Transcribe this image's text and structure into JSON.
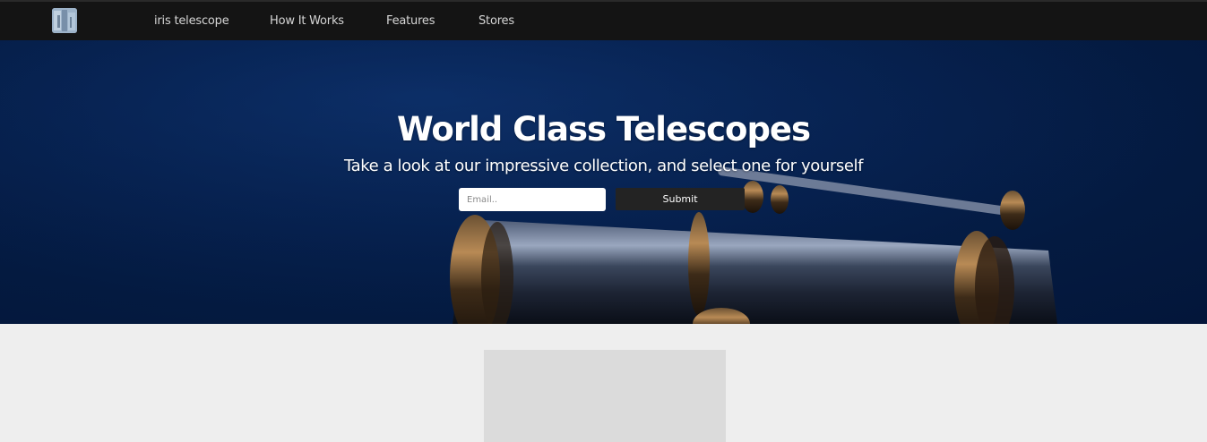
{
  "header": {
    "logo_icon": "telescope-logo-image",
    "nav": [
      {
        "label": "iris telescope"
      },
      {
        "label": "How It Works"
      },
      {
        "label": "Features"
      },
      {
        "label": "Stores"
      }
    ]
  },
  "hero": {
    "title": "World Class Telescopes",
    "subtitle": "Take a look at our impressive collection, and select one for yourself",
    "email_placeholder": "Email..",
    "submit_label": "Submit"
  },
  "colors": {
    "navbar_bg": "#141414",
    "hero_bg": "#06214f",
    "button_bg": "#232323",
    "page_bg": "#eeeeee",
    "placeholder_box": "#dbdbdb"
  }
}
